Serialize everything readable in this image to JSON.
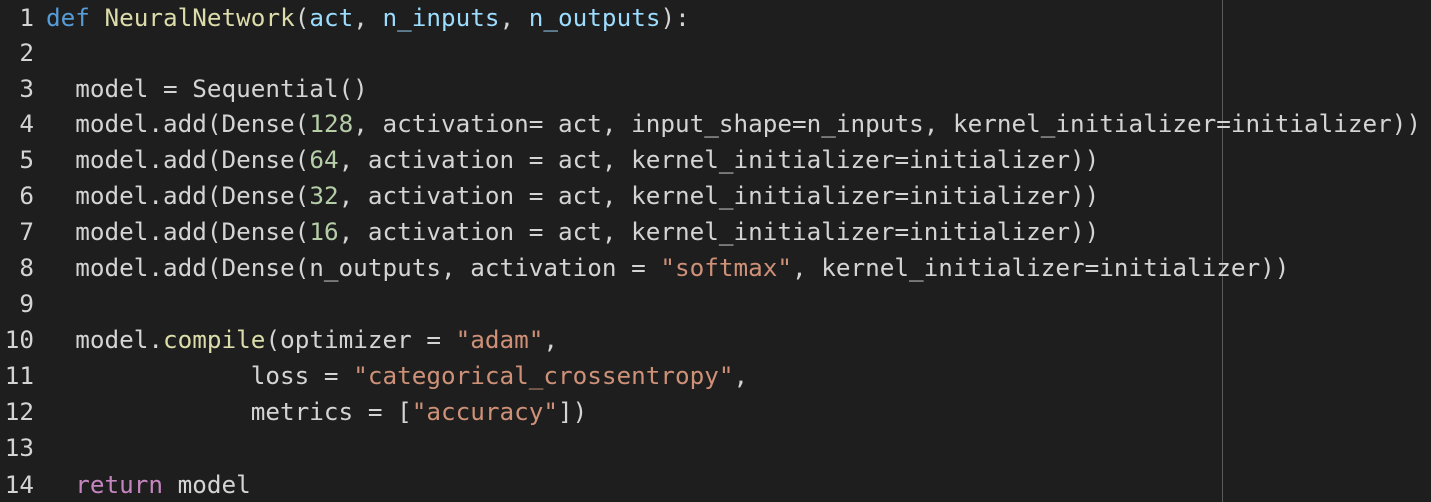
{
  "editor": {
    "colors": {
      "background": "#1e1e1e",
      "default_text": "#d4d4d4",
      "keyword": "#569cd6",
      "return_keyword": "#c586c0",
      "function": "#dcdcaa",
      "parameter": "#9cdcfe",
      "number": "#b5cea8",
      "string": "#ce9178",
      "ruler": "#5a5a5a"
    },
    "lines": [
      {
        "number": "1",
        "tokens": [
          {
            "t": "def",
            "c": "kw"
          },
          {
            "t": " ",
            "c": "tx"
          },
          {
            "t": "NeuralNetwork",
            "c": "fn"
          },
          {
            "t": "(",
            "c": "tx"
          },
          {
            "t": "act",
            "c": "pr"
          },
          {
            "t": ", ",
            "c": "tx"
          },
          {
            "t": "n_inputs",
            "c": "pr"
          },
          {
            "t": ", ",
            "c": "tx"
          },
          {
            "t": "n_outputs",
            "c": "pr"
          },
          {
            "t": "):",
            "c": "tx"
          }
        ]
      },
      {
        "number": "2",
        "tokens": []
      },
      {
        "number": "3",
        "tokens": [
          {
            "t": "  model = Sequential()",
            "c": "tx"
          }
        ]
      },
      {
        "number": "4",
        "tokens": [
          {
            "t": "  model.add(Dense(",
            "c": "tx"
          },
          {
            "t": "128",
            "c": "nm"
          },
          {
            "t": ", activation= act, input_shape=n_inputs, kernel_initializer=initializer))",
            "c": "tx"
          }
        ]
      },
      {
        "number": "5",
        "tokens": [
          {
            "t": "  model.add(Dense(",
            "c": "tx"
          },
          {
            "t": "64",
            "c": "nm"
          },
          {
            "t": ", activation = act, kernel_initializer=initializer))",
            "c": "tx"
          }
        ]
      },
      {
        "number": "6",
        "tokens": [
          {
            "t": "  model.add(Dense(",
            "c": "tx"
          },
          {
            "t": "32",
            "c": "nm"
          },
          {
            "t": ", activation = act, kernel_initializer=initializer))",
            "c": "tx"
          }
        ]
      },
      {
        "number": "7",
        "tokens": [
          {
            "t": "  model.add(Dense(",
            "c": "tx"
          },
          {
            "t": "16",
            "c": "nm"
          },
          {
            "t": ", activation = act, kernel_initializer=initializer))",
            "c": "tx"
          }
        ]
      },
      {
        "number": "8",
        "tokens": [
          {
            "t": "  model.add(Dense(n_outputs, activation = ",
            "c": "tx"
          },
          {
            "t": "\"softmax\"",
            "c": "st"
          },
          {
            "t": ", kernel_initializer=initializer))",
            "c": "tx"
          }
        ]
      },
      {
        "number": "9",
        "tokens": []
      },
      {
        "number": "10",
        "tokens": [
          {
            "t": "  model.",
            "c": "tx"
          },
          {
            "t": "compile",
            "c": "fn"
          },
          {
            "t": "(optimizer = ",
            "c": "tx"
          },
          {
            "t": "\"adam\"",
            "c": "st"
          },
          {
            "t": ",",
            "c": "tx"
          }
        ]
      },
      {
        "number": "11",
        "tokens": [
          {
            "t": "              loss = ",
            "c": "tx"
          },
          {
            "t": "\"categorical_crossentropy\"",
            "c": "st"
          },
          {
            "t": ",",
            "c": "tx"
          }
        ]
      },
      {
        "number": "12",
        "tokens": [
          {
            "t": "              metrics = [",
            "c": "tx"
          },
          {
            "t": "\"accuracy\"",
            "c": "st"
          },
          {
            "t": "])",
            "c": "tx"
          }
        ]
      },
      {
        "number": "13",
        "tokens": []
      },
      {
        "number": "14",
        "tokens": [
          {
            "t": "  ",
            "c": "tx"
          },
          {
            "t": "return",
            "c": "kw2"
          },
          {
            "t": " model",
            "c": "tx"
          }
        ]
      }
    ]
  }
}
